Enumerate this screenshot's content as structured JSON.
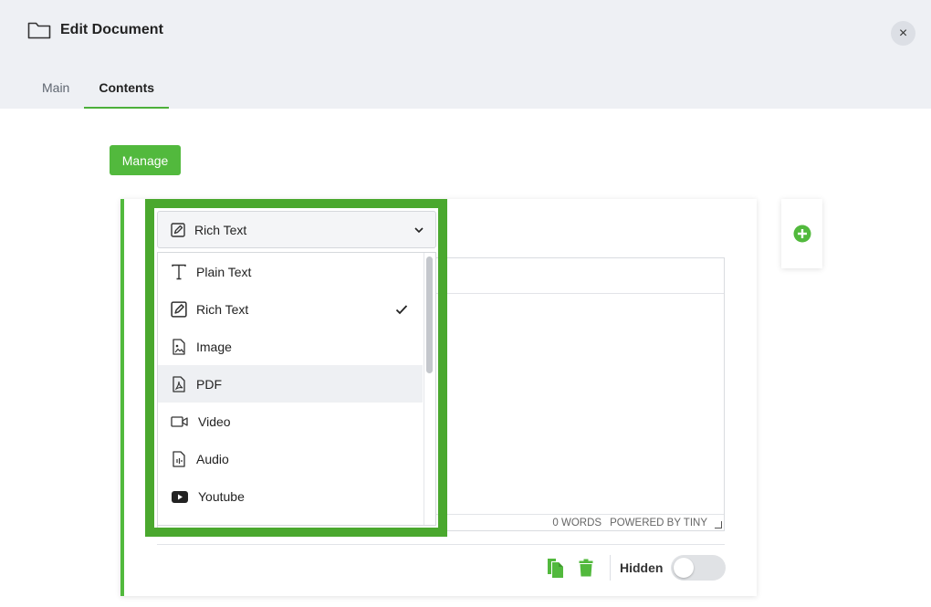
{
  "window": {
    "title": "Edit Document",
    "close_symbol": "×"
  },
  "tabs": [
    {
      "label": "Main",
      "active": false
    },
    {
      "label": "Contents",
      "active": true
    }
  ],
  "toolbar": {
    "manage_label": "Manage"
  },
  "content_type_select": {
    "selected": "Rich Text",
    "options": [
      {
        "label": "Plain Text",
        "icon": "text-icon"
      },
      {
        "label": "Rich Text",
        "icon": "edit-icon",
        "checked": true
      },
      {
        "label": "Image",
        "icon": "image-file-icon"
      },
      {
        "label": "PDF",
        "icon": "pdf-file-icon",
        "hovered": true
      },
      {
        "label": "Video",
        "icon": "video-camera-icon"
      },
      {
        "label": "Audio",
        "icon": "audio-file-icon"
      },
      {
        "label": "Youtube",
        "icon": "youtube-icon"
      }
    ]
  },
  "editor": {
    "word_count": "0 WORDS",
    "powered_by": "POWERED BY TINY"
  },
  "footer": {
    "hidden_label": "Hidden",
    "hidden_on": false
  },
  "colors": {
    "accent": "#52b93d",
    "highlight_border": "#4aa82e",
    "header_bg": "#eef0f4"
  }
}
